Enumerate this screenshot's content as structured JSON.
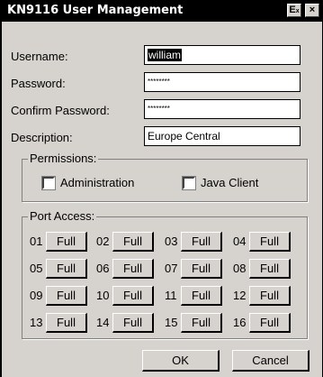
{
  "window": {
    "title": "KN9116 User Management"
  },
  "titlebar_buttons": {
    "help": "E",
    "help_sub": "x",
    "close": "×"
  },
  "form": {
    "username": {
      "label": "Username:",
      "value": "william"
    },
    "password": {
      "label": "Password:",
      "value": "********"
    },
    "confirm_password": {
      "label": "Confirm Password:",
      "value": "********"
    },
    "description": {
      "label": "Description:",
      "value": "Europe Central"
    }
  },
  "permissions": {
    "title": "Permissions:",
    "administration": {
      "label": "Administration",
      "checked": false
    },
    "java_client": {
      "label": "Java Client",
      "checked": false
    }
  },
  "port_access": {
    "title": "Port Access:",
    "ports": [
      {
        "num": "01",
        "access": "Full"
      },
      {
        "num": "02",
        "access": "Full"
      },
      {
        "num": "03",
        "access": "Full"
      },
      {
        "num": "04",
        "access": "Full"
      },
      {
        "num": "05",
        "access": "Full"
      },
      {
        "num": "06",
        "access": "Full"
      },
      {
        "num": "07",
        "access": "Full"
      },
      {
        "num": "08",
        "access": "Full"
      },
      {
        "num": "09",
        "access": "Full"
      },
      {
        "num": "10",
        "access": "Full"
      },
      {
        "num": "11",
        "access": "Full"
      },
      {
        "num": "12",
        "access": "Full"
      },
      {
        "num": "13",
        "access": "Full"
      },
      {
        "num": "14",
        "access": "Full"
      },
      {
        "num": "15",
        "access": "Full"
      },
      {
        "num": "16",
        "access": "Full"
      }
    ]
  },
  "buttons": {
    "ok": "OK",
    "cancel": "Cancel"
  }
}
